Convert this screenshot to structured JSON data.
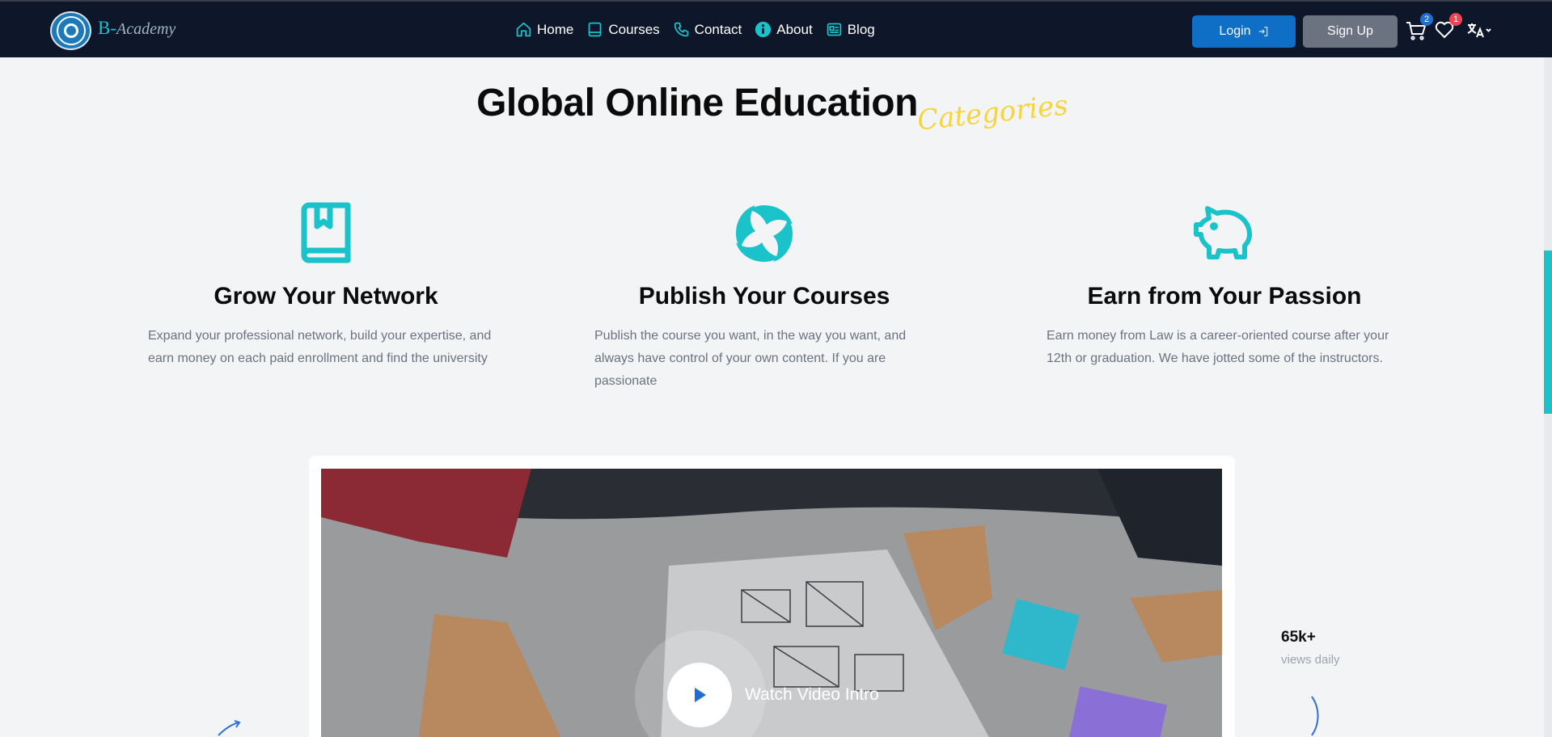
{
  "header": {
    "brand_prefix": "B-",
    "brand_name": "Academy",
    "nav": [
      {
        "label": "Home",
        "icon": "home-icon"
      },
      {
        "label": "Courses",
        "icon": "book-icon"
      },
      {
        "label": "Contact",
        "icon": "phone-icon"
      },
      {
        "label": "About",
        "icon": "info-icon"
      },
      {
        "label": "Blog",
        "icon": "news-icon"
      }
    ],
    "login_label": "Login",
    "signup_label": "Sign Up",
    "cart_count": "2",
    "wishlist_count": "1",
    "accent_color": "#10c6cf"
  },
  "section": {
    "title": "Global Online Education",
    "script_word": "Categories"
  },
  "features": [
    {
      "icon": "bookmark-book-icon",
      "title": "Grow Your Network",
      "text": "Expand your professional network, build your expertise, and earn money on each paid enrollment and find the university"
    },
    {
      "icon": "swirl-icon",
      "title": "Publish Your Courses",
      "text": "Publish the course you want, in the way you want, and always have control of your own content. If you are passionate"
    },
    {
      "icon": "piggy-bank-icon",
      "title": "Earn from Your Passion",
      "text": "Earn money from Law is a career-oriented course after your 12th or graduation. We have jotted some of the instructors."
    }
  ],
  "video": {
    "label": "Watch Video Intro"
  },
  "stats": {
    "value": "65k+",
    "caption": "views daily"
  }
}
